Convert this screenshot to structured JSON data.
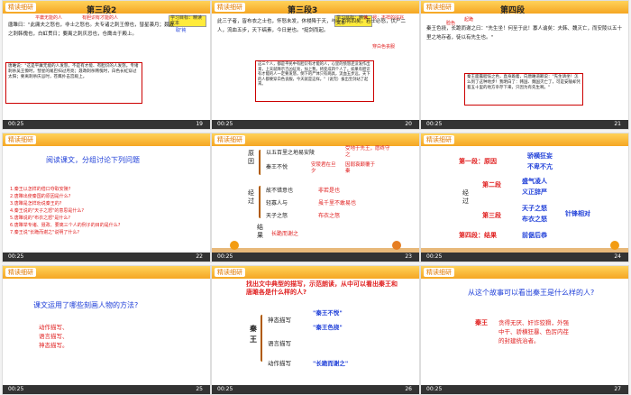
{
  "common": {
    "header_tag": "精读细研",
    "time": "00:25"
  },
  "slides": [
    {
      "num": "19",
      "title": "第三段2",
      "goal": "学习目标：精读文本",
      "notes": [
        "平庸无能的人",
        "有胆识有才能的人",
        "非士之怒也，非士之怒也。",
        "取'钝"
      ],
      "text": "唐雎曰：\"此庸夫之怒也，非士之怒也。夫专诸之刺王僚也，彗星袭月；聂政之刺韩傀也，白虹贯日；要离之刺庆忌也，仓鹰击于殿上。",
      "box_text": "唐雎说：\"这是平庸无能的人发怒，不是有才能、有胆识的人发怒。专诸刺杀吴王僚时，彗星的尾巴扫过月亮；聂政刺杀韩傀时，白色长虹穿过太阳；要离刺杀庆忌时，苍鹰扑击宫殿上。"
    },
    {
      "num": "20",
      "title": "第三段3",
      "goal": "学习目标：精读文本",
      "notes": [
        "吉凶的征兆",
        "这些事情",
        "降临，将要",
        "休、祲：不祥的征兆"
      ],
      "text": "此三子者，皆布衣之士也，怀怒未发，休祲降于天，与臣而将四矣。若士必怒，伏尸二人，流血五步，天下缟素，今日是也。\"挺剑而起。",
      "red_notes": [
        "穿白色丧服"
      ],
      "box_text": "这三个人，都是平民中有胆识有才能的人，心里的愤怒还没发作出来，上天就降示吉凶征兆，加上我，将变成四个人了。如果有胆识有才能的人一定要发怒，倒下的尸体只有两具，流血五步远，天下的人都要穿白色丧服，今天就是这样。\"（说完）拔出宝剑站了起来。"
    },
    {
      "num": "21",
      "title": "第四段",
      "goal": "",
      "notes": [
        "起跪",
        "脸色",
        "敬佩",
        "是",
        "使……觉悟",
        "庆后",
        "明白",
        "还"
      ],
      "text": "秦王色挠，长跪而谢之曰：\"先生坐！何至于此！寡人谕矣：夫韩、魏灭亡，而安陵以五十里之地存者，徒以有先生也。\"",
      "box_text": "秦王面露胆怯之色，直身跪着，向唐雎道歉说：\"先生请坐！怎么到了这种地步！我明白了：韩国、魏国灭亡了，可是安陵却凭着五十里的地方幸存下来，只因为有先生啊。\""
    },
    {
      "num": "22",
      "title": "阅读课文，分组讨论下列问题",
      "questions": [
        "1.秦王以怎样的借口夺取安陵?",
        "2.唐雎出使秦国的原因是什么?",
        "3.唐雎是怎样劝说秦王的?",
        "4.秦王说的\"天子之怒\"的意思是什么?",
        "5.唐雎说的\"布衣之怒\"是什么?",
        "6.唐雎举专诸、聂政、要离三个人的例子的目的是什么?",
        "7.秦王说\"长跪而谢之\"说明了什么?"
      ]
    },
    {
      "num": "23",
      "labels": [
        "原因",
        "经过",
        "结果"
      ],
      "left_items": [
        "以五百里之地易安陵",
        "秦王不悦",
        "故不错意也",
        "轻寡人与",
        "天子之怒",
        "长跪而谢之"
      ],
      "right_items": [
        "受地于先王，愿终守之",
        "安陵君在旦夕",
        "因弱衰颠覆于秦",
        "非若是也",
        "虽千里不敢易也",
        "布衣之怒"
      ]
    },
    {
      "num": "24",
      "sections": [
        "第一段：原因",
        "第二段",
        "第三段",
        "第四段：结果"
      ],
      "items": [
        "骄横狂妄",
        "不卑不亢",
        "盛气凌人",
        "义正辞严",
        "天子之怒",
        "布衣之怒",
        "针锋相对",
        "前倨后恭"
      ],
      "label": "经过"
    },
    {
      "num": "25",
      "question": "课文运用了哪些刻画人物的方法?",
      "answers": [
        "动作描写、",
        "语言描写、",
        "神态描写。"
      ]
    },
    {
      "num": "26",
      "question": "找出文中典型的描写，示范朗读，从中可以看出秦王和唐雎各是什么样的人?",
      "subject": "秦王",
      "rows": [
        {
          "type": "神态描写",
          "quote": "\"秦王不悦\""
        },
        {
          "type": "",
          "quote": "\"秦王色挠\""
        },
        {
          "type": "语言描写",
          "quote": ""
        },
        {
          "type": "动作描写",
          "quote": "\"长跪而谢之\""
        }
      ]
    },
    {
      "num": "27",
      "question": "从这个故事可以看出秦王是什么样的人?",
      "subject": "秦王",
      "answer": "贪得无厌、奸诈狡猾，外强中干、骄横狂暴、色厉内荏的封建统治者。"
    }
  ]
}
